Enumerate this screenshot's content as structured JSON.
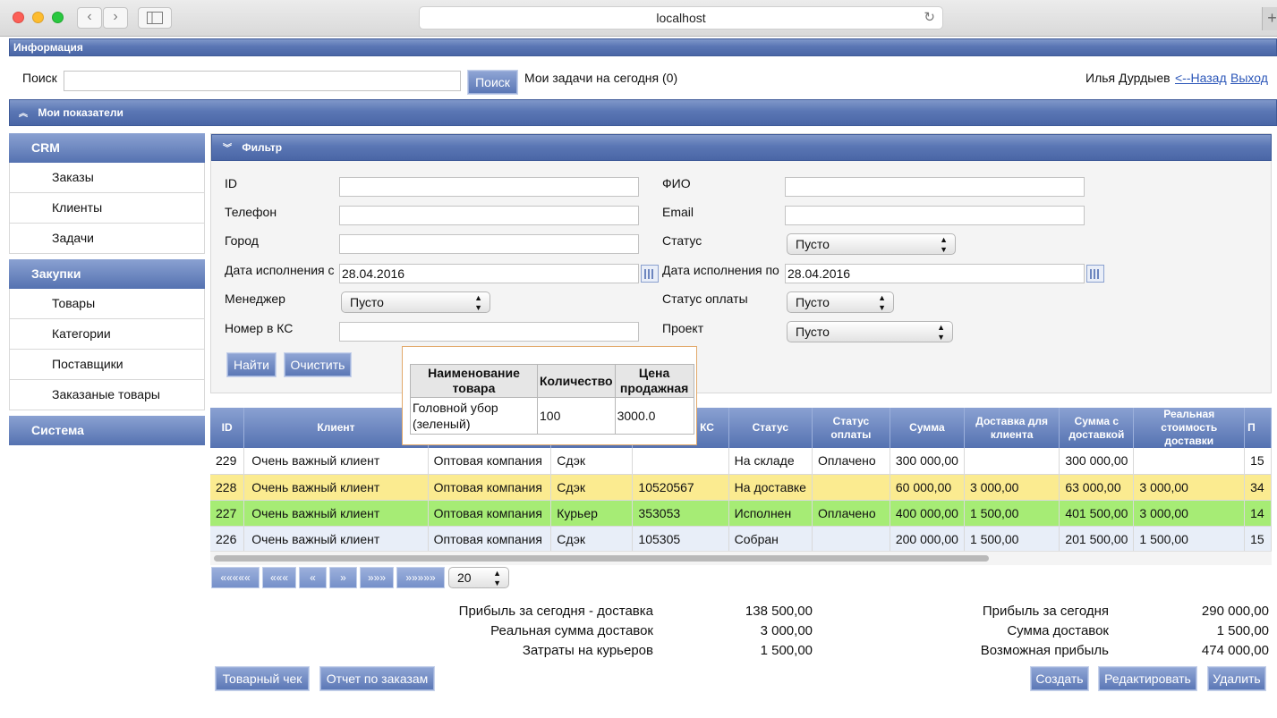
{
  "browser": {
    "url": "localhost",
    "back": "‹",
    "forward": "›",
    "reload": "↻",
    "new_tab": "+"
  },
  "header": {
    "info_bar": "Информация",
    "search_label": "Поиск",
    "search_value": "",
    "search_button": "Поиск",
    "tasks_today": "Мои задачи на сегодня",
    "tasks_count": "(0)",
    "user_name": "Илья Дурдыев",
    "back_link": "<--Назад",
    "logout_link": "Выход",
    "indicators_bar": "Мои показатели"
  },
  "sidebar": {
    "crm": {
      "title": "CRM",
      "items": [
        "Заказы",
        "Клиенты",
        "Задачи"
      ]
    },
    "purchases": {
      "title": "Закупки",
      "items": [
        "Товары",
        "Категории",
        "Поставщики",
        "Заказаные товары"
      ]
    },
    "system": {
      "title": "Система"
    }
  },
  "filter": {
    "title": "Фильтр",
    "id_label": "ID",
    "id_value": "",
    "phone_label": "Телефон",
    "phone_value": "",
    "city_label": "Город",
    "city_value": "",
    "date_from_label": "Дата исполнения с",
    "date_from_value": "28.04.2016",
    "manager_label": "Менеджер",
    "manager_value": "Пусто",
    "ks_label": "Номер в КС",
    "ks_value": "",
    "fio_label": "ФИО",
    "fio_value": "",
    "email_label": "Email",
    "email_value": "",
    "status_label": "Статус",
    "status_value": "Пусто",
    "date_to_label": "Дата исполнения по",
    "date_to_value": "28.04.2016",
    "pay_status_label": "Статус оплаты",
    "pay_status_value": "Пусто",
    "project_label": "Проект",
    "project_value": "Пусто",
    "find_button": "Найти",
    "clear_button": "Очистить"
  },
  "popup": {
    "headers": [
      "Наименование товара",
      "Количество",
      "Цена продажная"
    ],
    "rows": [
      [
        "Головной убор (зеленый)",
        "100",
        "3000.0"
      ]
    ]
  },
  "orders_table": {
    "columns": [
      "ID",
      "Клиент",
      "",
      "",
      "в КС",
      "Статус",
      "Статус оплаты",
      "Сумма",
      "Доставка для клиента",
      "Сумма с доставкой",
      "Реальная стоимость доставки",
      "П"
    ],
    "rows": [
      [
        "229",
        "Очень важный клиент",
        "Оптовая компания",
        "Сдэк",
        "",
        "На складе",
        "Оплачено",
        "300 000,00",
        "",
        "300 000,00",
        "",
        "15"
      ],
      [
        "228",
        "Очень важный клиент",
        "Оптовая компания",
        "Сдэк",
        "10520567",
        "На доставке",
        "",
        "60 000,00",
        "3 000,00",
        "63 000,00",
        "3 000,00",
        "34"
      ],
      [
        "227",
        "Очень важный клиент",
        "Оптовая компания",
        "Курьер",
        "353053",
        "Исполнен",
        "Оплачено",
        "400 000,00",
        "1 500,00",
        "401 500,00",
        "3 000,00",
        "14"
      ],
      [
        "226",
        "Очень важный клиент",
        "Оптовая компания",
        "Сдэк",
        "105305",
        "Собран",
        "",
        "200 000,00",
        "1 500,00",
        "201 500,00",
        "1 500,00",
        "15"
      ]
    ]
  },
  "pager": {
    "first": "«««««",
    "prev_many": "«««",
    "prev": "«",
    "next": "»",
    "next_many": "»»»",
    "last": "»»»»»",
    "page_size": "20"
  },
  "totals": {
    "left": [
      {
        "label": "Прибыль за сегодня - доставка",
        "value": "138 500,00"
      },
      {
        "label": "Реальная сумма доставок",
        "value": "3 000,00"
      },
      {
        "label": "Затраты на курьеров",
        "value": "1 500,00"
      }
    ],
    "right": [
      {
        "label": "Прибыль за сегодня",
        "value": "290 000,00"
      },
      {
        "label": "Сумма доставок",
        "value": "1 500,00"
      },
      {
        "label": "Возможная прибыль",
        "value": "474 000,00"
      }
    ]
  },
  "actions": {
    "receipt": "Товарный чек",
    "orders_report": "Отчет по заказам",
    "create": "Создать",
    "edit": "Редактировать",
    "delete": "Удалить"
  }
}
